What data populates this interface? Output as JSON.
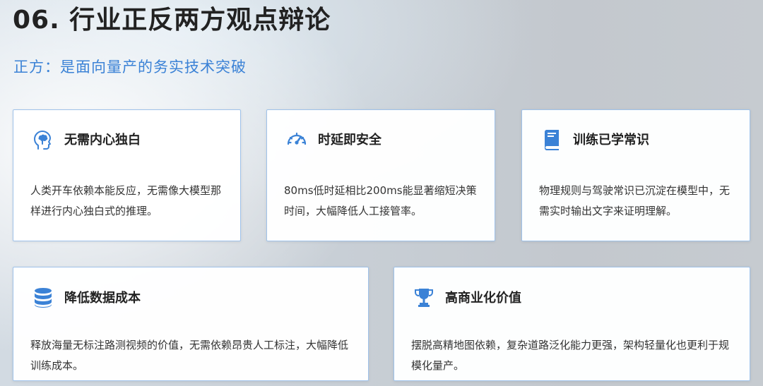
{
  "header": {
    "title": "06. 行业正反两方观点辩论",
    "subtitle": "正方：是面向量产的务实技术突破"
  },
  "accent_color": "#3b82d6",
  "cards": [
    {
      "icon": "brain-head-icon",
      "title": "无需内心独白",
      "body": "人类开车依赖本能反应，无需像大模型那样进行内心独白式的推理。"
    },
    {
      "icon": "speedometer-icon",
      "title": "时延即安全",
      "body": "80ms低时延相比200ms能显著缩短决策时间，大幅降低人工接管率。"
    },
    {
      "icon": "book-icon",
      "title": "训练已学常识",
      "body": "物理规则与驾驶常识已沉淀在模型中，无需实时输出文字来证明理解。"
    },
    {
      "icon": "database-icon",
      "title": "降低数据成本",
      "body": "释放海量无标注路测视频的价值，无需依赖昂贵人工标注，大幅降低训练成本。"
    },
    {
      "icon": "trophy-icon",
      "title": "高商业化价值",
      "body": "摆脱高精地图依赖，复杂道路泛化能力更强，架构轻量化也更利于规模化量产。"
    }
  ]
}
